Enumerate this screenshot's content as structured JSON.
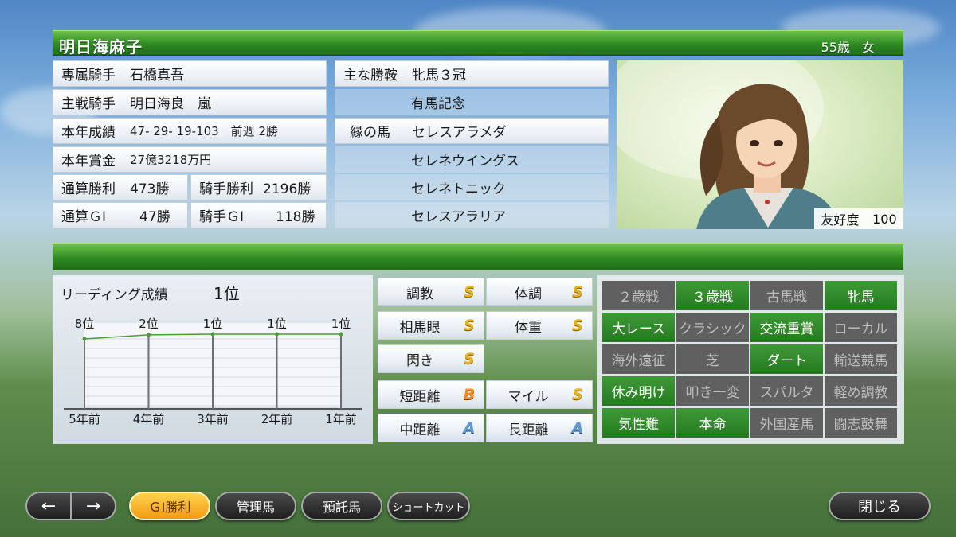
{
  "header": {
    "name": "明日海麻子",
    "age": "55歳",
    "sex": "女"
  },
  "info": {
    "exclusive_jockey_label": "専属騎手",
    "exclusive_jockey": "石橋真吾",
    "main_jockey_label": "主戦騎手",
    "main_jockey": "明日海良　嵐",
    "year_record_label": "本年成績",
    "year_record": "47- 29- 19-103　前週 2勝",
    "year_prize_label": "本年賞金",
    "year_prize": "27億3218万円",
    "total_wins_label": "通算勝利",
    "total_wins": "473勝",
    "jockey_wins_label": "騎手勝利",
    "jockey_wins": "2196勝",
    "total_g1_label": "通算ＧⅠ",
    "total_g1": "47勝",
    "jockey_g1_label": "騎手ＧⅠ",
    "jockey_g1": "118勝"
  },
  "victories": {
    "label": "主な勝鞍",
    "items": [
      "牝馬３冠",
      "有馬記念"
    ]
  },
  "related_horses": {
    "label": "縁の馬",
    "items": [
      "セレスアラメダ",
      "セレネウイングス",
      "セレネトニック",
      "セレスアラリア"
    ]
  },
  "portrait": {
    "friendship_label": "友好度",
    "friendship": "100"
  },
  "leading": {
    "title": "リーディング成績",
    "rank": "1位",
    "chart_data": {
      "type": "line",
      "categories": [
        "5年前",
        "4年前",
        "3年前",
        "2年前",
        "1年前"
      ],
      "values": [
        8,
        2,
        1,
        1,
        1
      ],
      "point_labels": [
        "8位",
        "2位",
        "1位",
        "1位",
        "1位"
      ],
      "y_inverted": true,
      "color": "#4f9a3a"
    }
  },
  "aptitudes": [
    {
      "name": "調教",
      "grade": "S"
    },
    {
      "name": "体調",
      "grade": "S"
    },
    {
      "name": "相馬眼",
      "grade": "S"
    },
    {
      "name": "体重",
      "grade": "S"
    },
    {
      "name": "閃き",
      "grade": "S"
    },
    {
      "name": "短距離",
      "grade": "B"
    },
    {
      "name": "マイル",
      "grade": "S"
    },
    {
      "name": "中距離",
      "grade": "A"
    },
    {
      "name": "長距離",
      "grade": "A"
    }
  ],
  "tags": [
    {
      "label": "２歳戦",
      "on": false
    },
    {
      "label": "３歳戦",
      "on": true
    },
    {
      "label": "古馬戦",
      "on": false
    },
    {
      "label": "牝馬",
      "on": true
    },
    {
      "label": "大レース",
      "on": true
    },
    {
      "label": "クラシック",
      "on": false
    },
    {
      "label": "交流重賞",
      "on": true
    },
    {
      "label": "ローカル",
      "on": false
    },
    {
      "label": "海外遠征",
      "on": false
    },
    {
      "label": "芝",
      "on": false
    },
    {
      "label": "ダート",
      "on": true
    },
    {
      "label": "輸送競馬",
      "on": false
    },
    {
      "label": "休み明け",
      "on": true
    },
    {
      "label": "叩き一変",
      "on": false
    },
    {
      "label": "スパルタ",
      "on": false
    },
    {
      "label": "軽め調教",
      "on": false
    },
    {
      "label": "気性難",
      "on": true
    },
    {
      "label": "本命",
      "on": true
    },
    {
      "label": "外国産馬",
      "on": false
    },
    {
      "label": "闘志鼓舞",
      "on": false
    }
  ],
  "buttons": {
    "prev": "←",
    "next": "→",
    "g1_wins": "ＧⅠ勝利",
    "managed": "管理馬",
    "entrusted": "預託馬",
    "shortcut": "ショートカット",
    "close": "閉じる"
  }
}
